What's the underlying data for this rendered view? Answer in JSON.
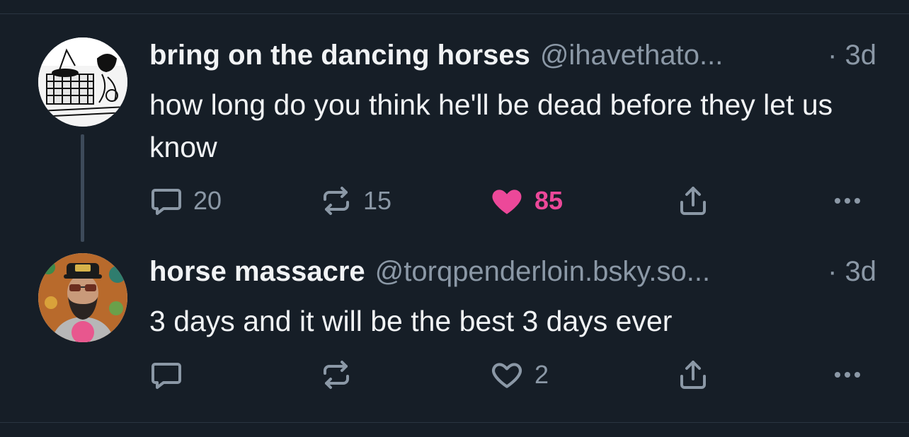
{
  "posts": [
    {
      "display_name": "bring on the dancing horses",
      "handle": "@ihavethato...",
      "time": "· 3d",
      "text": "how long do you think he'll be dead before they let us know",
      "reply_count": "20",
      "repost_count": "15",
      "like_count": "85",
      "liked": true
    },
    {
      "display_name": "horse massacre",
      "handle": "@torqpenderloin.bsky.so...",
      "time": "· 3d",
      "text": "3 days and it will be the best 3 days ever",
      "reply_count": "",
      "repost_count": "",
      "like_count": "2",
      "liked": false
    }
  ],
  "colors": {
    "background": "#161e27",
    "muted": "#8b98a6",
    "like": "#ec4899"
  }
}
